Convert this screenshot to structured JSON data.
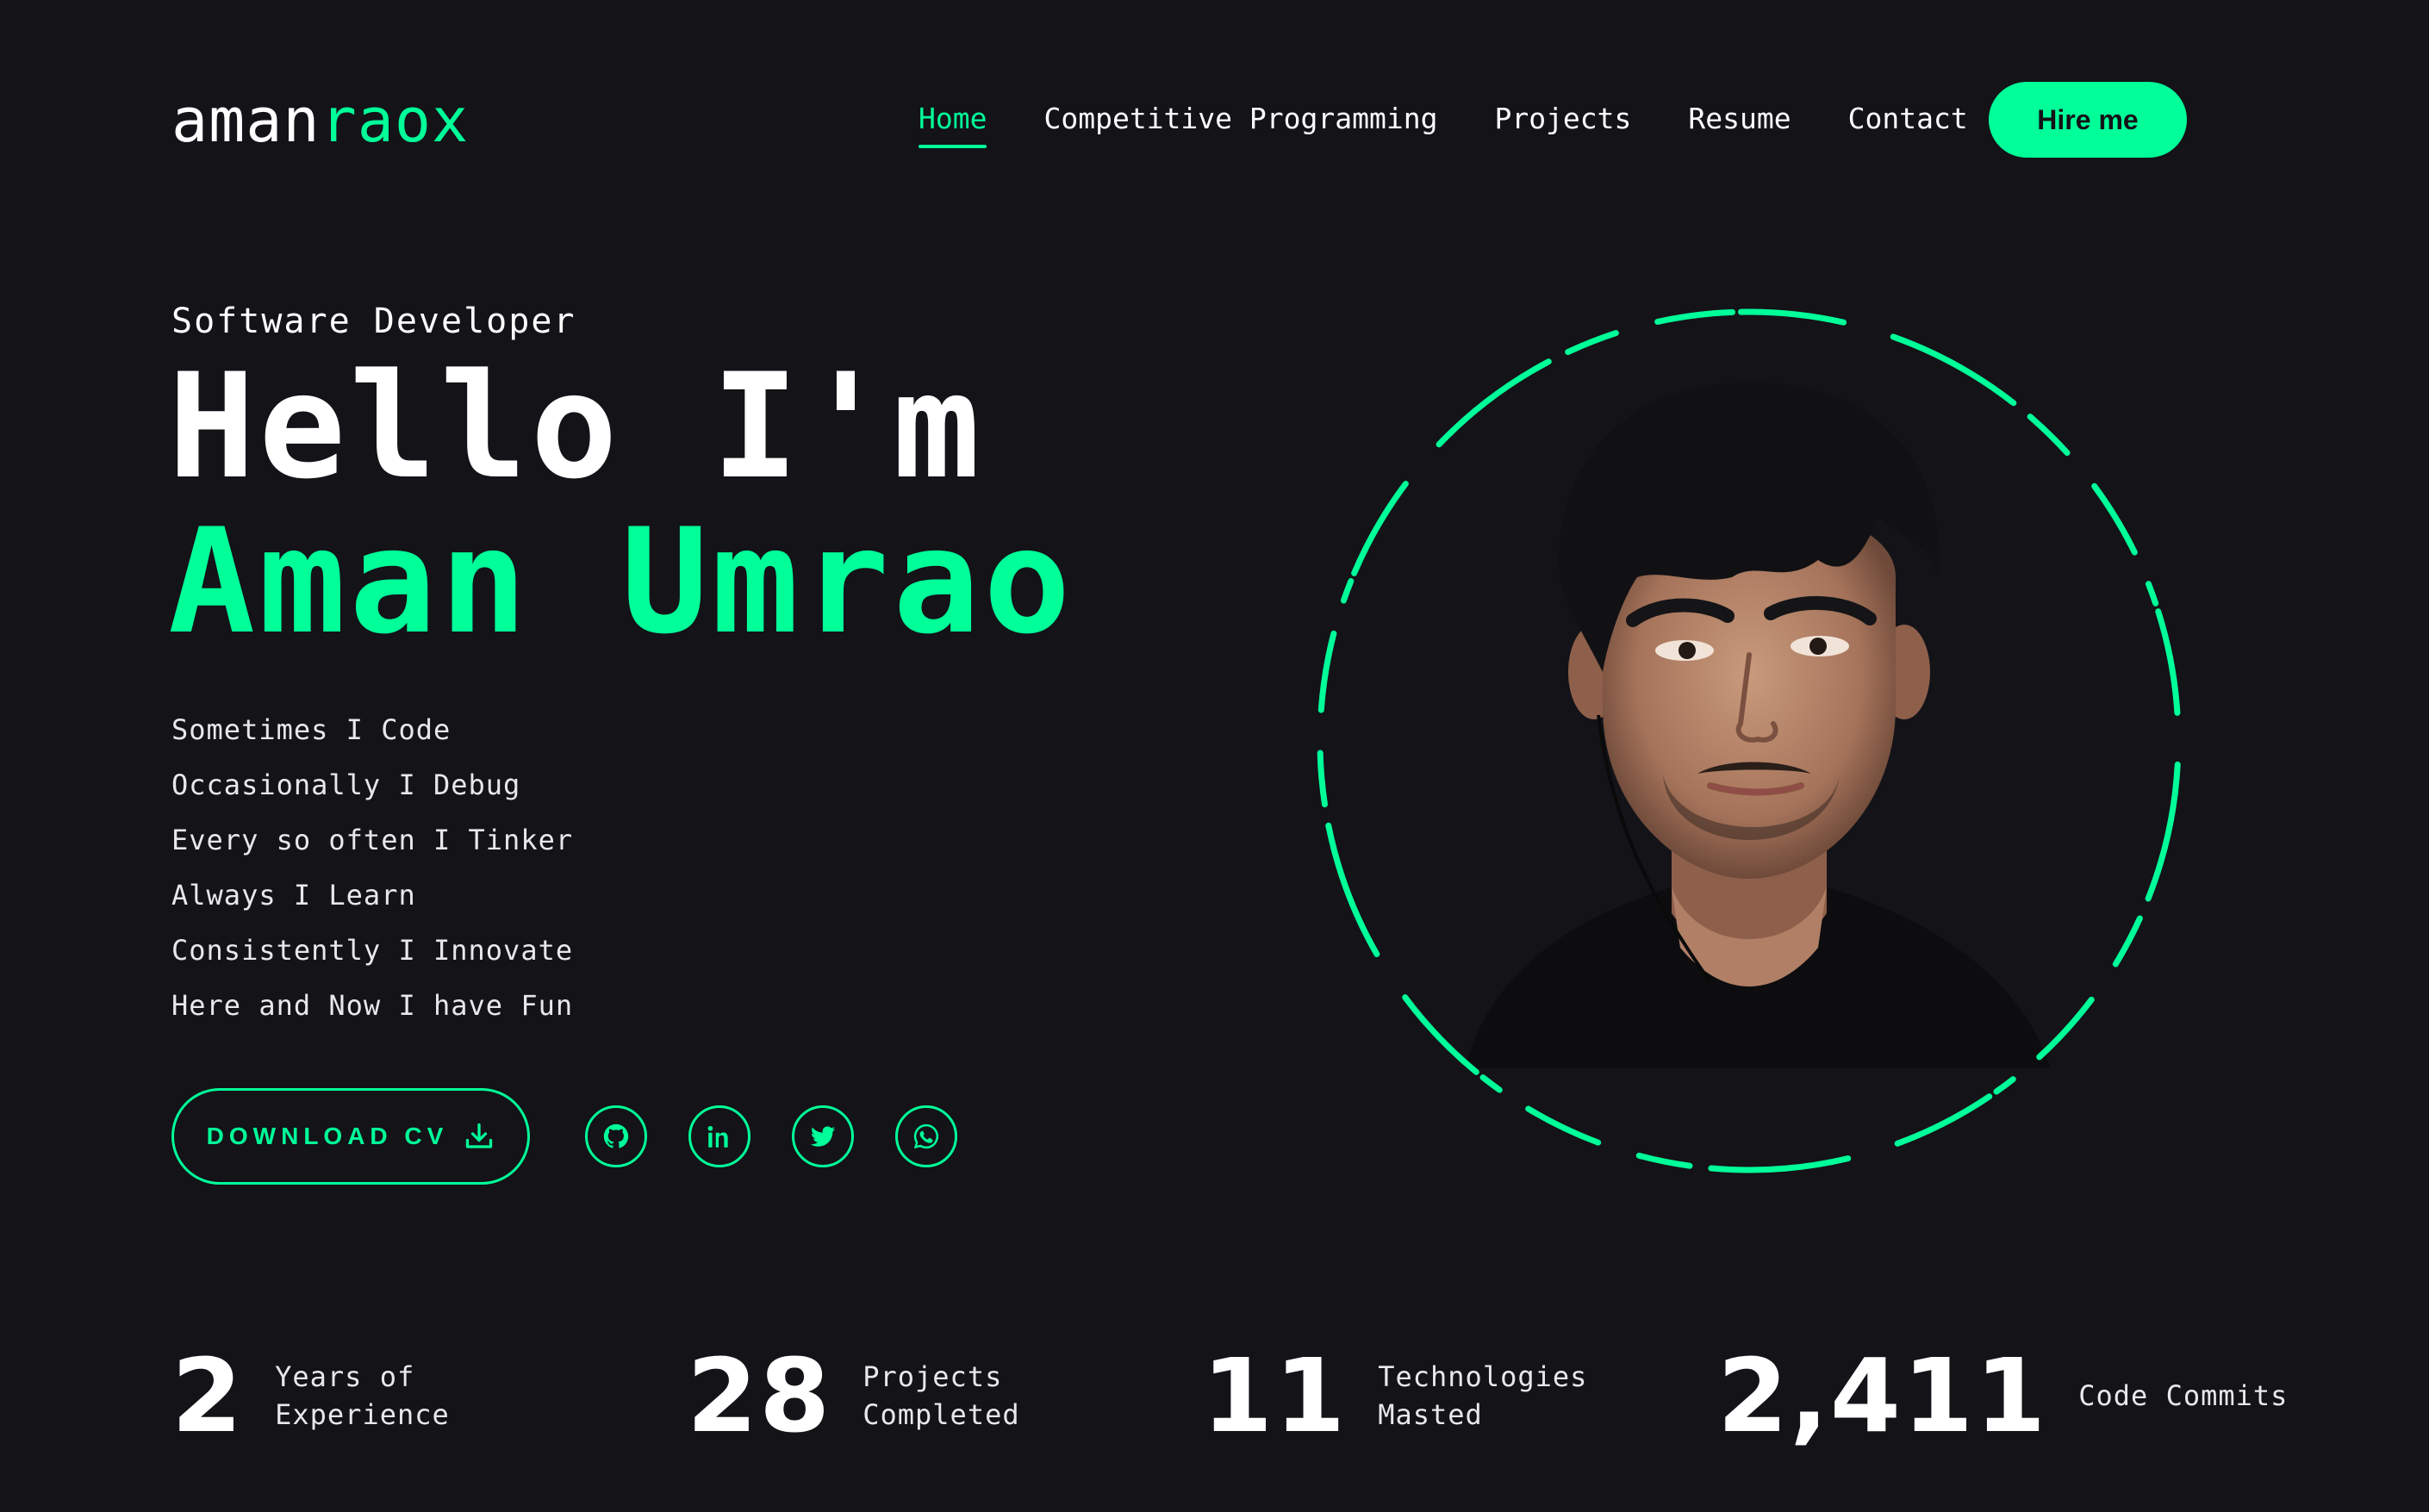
{
  "header": {
    "logo_main": "aman",
    "logo_accent": "raox",
    "nav": [
      {
        "label": "Home",
        "active": true
      },
      {
        "label": "Competitive Programming",
        "active": false
      },
      {
        "label": "Projects",
        "active": false
      },
      {
        "label": "Resume",
        "active": false
      },
      {
        "label": "Contact",
        "active": false
      }
    ],
    "hire_label": "Hire me"
  },
  "hero": {
    "role": "Software Developer",
    "greeting": "Hello I'm",
    "name": "Aman Umrao",
    "lines": [
      "Sometimes I Code",
      "Occasionally I Debug",
      "Every so often I Tinker",
      "Always I Learn",
      "Consistently I Innovate",
      "Here and Now I have Fun"
    ],
    "download_label": "DOWNLOAD CV",
    "socials": [
      "github-icon",
      "linkedin-icon",
      "twitter-icon",
      "whatsapp-icon"
    ]
  },
  "stats": [
    {
      "value": "2",
      "label": "Years of Experience"
    },
    {
      "value": "28",
      "label": "Projects Completed"
    },
    {
      "value": "11",
      "label": "Technologies Masted"
    },
    {
      "value": "2,411",
      "label": "Code Commits"
    }
  ],
  "colors": {
    "accent": "#00ff99",
    "background": "#131318",
    "text": "#ffffff"
  }
}
